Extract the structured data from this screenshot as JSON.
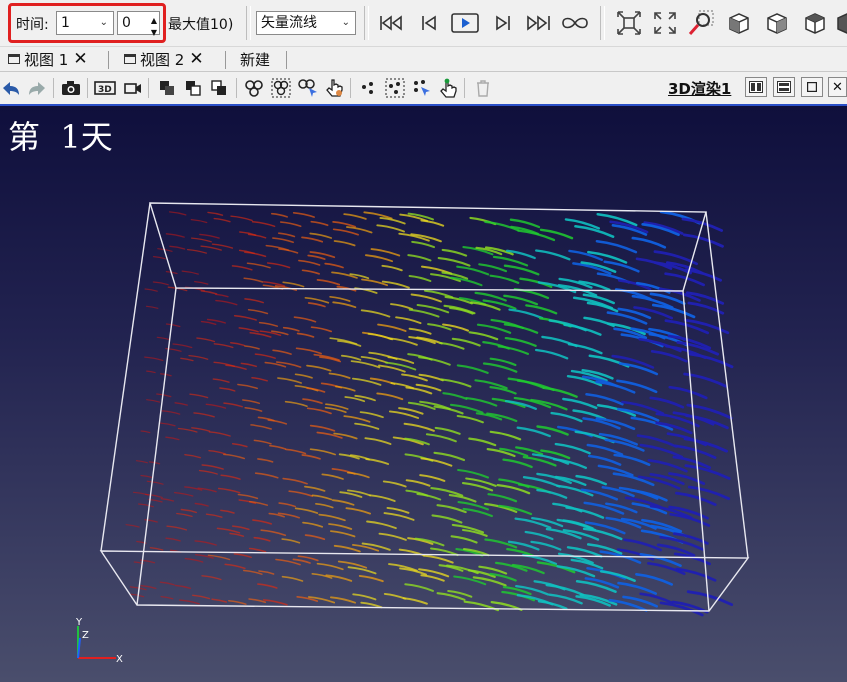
{
  "toolbar": {
    "time_label": "时间:",
    "time_value": "1",
    "step_value": "0",
    "max_label": "最大值10)",
    "representation": "矢量流线",
    "highlight_color": "#e02020"
  },
  "tabs": [
    {
      "label": "视图 1",
      "close": "✕"
    },
    {
      "label": "视图 2",
      "close": "✕"
    },
    {
      "label": "新建"
    }
  ],
  "render_view": {
    "title": "3D渲染1",
    "annotation": "第  1天"
  },
  "axes": {
    "x": "X",
    "y": "Y",
    "z": "Z"
  },
  "colors": {
    "viewport_top": "#0f0f3c",
    "viewport_bottom": "#4a4e6c",
    "active_border": "#2b50c8",
    "outline_box": "#e8e8f0"
  },
  "colormap": [
    "#c01818",
    "#e02a10",
    "#f06010",
    "#f0a010",
    "#e8d820",
    "#90e020",
    "#20c830",
    "#10c0c0",
    "#1060e0",
    "#2020b0"
  ]
}
